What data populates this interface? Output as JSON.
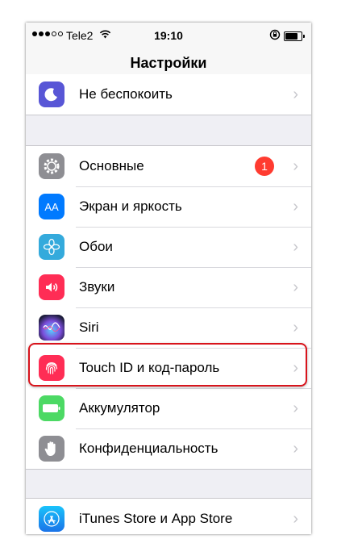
{
  "status": {
    "carrier": "Tele2",
    "time": "19:10",
    "signal_bars": 3,
    "signal_total": 5,
    "battery_level": 0.8
  },
  "nav": {
    "title": "Настройки"
  },
  "group1": [
    {
      "label": "Не беспокоить",
      "icon": "moon-icon",
      "color": "#5856d6"
    }
  ],
  "group2": [
    {
      "label": "Основные",
      "icon": "gear-icon",
      "color": "#8e8e93",
      "badge": "1"
    },
    {
      "label": "Экран и яркость",
      "icon": "text-size-icon",
      "color": "#007aff",
      "icon_text": "AA"
    },
    {
      "label": "Обои",
      "icon": "flower-icon",
      "color": "#34aadc"
    },
    {
      "label": "Звуки",
      "icon": "speaker-icon",
      "color": "#ff2d55"
    },
    {
      "label": "Siri",
      "icon": "siri-icon",
      "color": "#1c1c3a"
    },
    {
      "label": "Touch ID и код-пароль",
      "icon": "fingerprint-icon",
      "color": "#ff2d55"
    },
    {
      "label": "Аккумулятор",
      "icon": "battery-icon",
      "color": "#4cd964"
    },
    {
      "label": "Конфиденциальность",
      "icon": "hand-icon",
      "color": "#8e8e93"
    }
  ],
  "group3": [
    {
      "label": "iTunes Store и App Store",
      "icon": "app-store-icon",
      "color": "#1a8cf0"
    }
  ],
  "chevron": "›"
}
